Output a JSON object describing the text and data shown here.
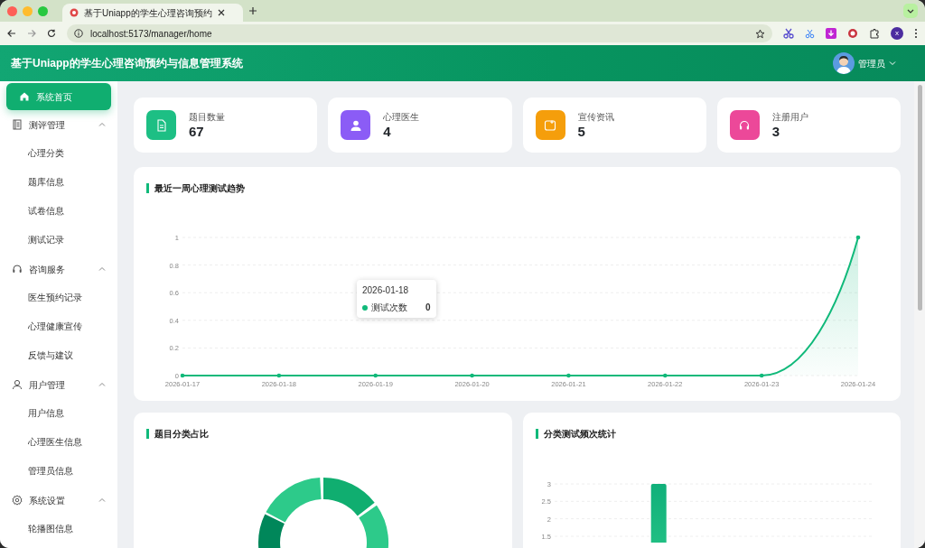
{
  "browser": {
    "tab": {
      "title": "基于Uniapp的学生心理咨询预约",
      "selected": true
    },
    "address": "localhost:5173/manager/home",
    "profile_initial": "x"
  },
  "header": {
    "title": "基于Uniapp的学生心理咨询预约与信息管理系统",
    "user": "管理员"
  },
  "sidebar": {
    "items": [
      {
        "label": "系统首页",
        "selected": true
      },
      {
        "label": "测评管理",
        "selected": false,
        "expanded": true,
        "children": [
          {
            "label": "心理分类",
            "selected": false
          },
          {
            "label": "题库信息",
            "selected": false
          },
          {
            "label": "试卷信息",
            "selected": false
          },
          {
            "label": "测试记录",
            "selected": false
          }
        ]
      },
      {
        "label": "咨询服务",
        "selected": false,
        "expanded": true,
        "children": [
          {
            "label": "医生预约记录",
            "selected": false
          },
          {
            "label": "心理健康宣传",
            "selected": false
          },
          {
            "label": "反馈与建议",
            "selected": false
          }
        ]
      },
      {
        "label": "用户管理",
        "selected": false,
        "expanded": true,
        "children": [
          {
            "label": "用户信息",
            "selected": false
          },
          {
            "label": "心理医生信息",
            "selected": false
          },
          {
            "label": "管理员信息",
            "selected": false
          }
        ]
      },
      {
        "label": "系统设置",
        "selected": false,
        "expanded": true,
        "children": [
          {
            "label": "轮播图信息",
            "selected": false
          }
        ]
      }
    ]
  },
  "stats": [
    {
      "label": "题目数量",
      "value": "67",
      "color": "#1dbf84"
    },
    {
      "label": "心理医生",
      "value": "4",
      "color": "#8b5cf6"
    },
    {
      "label": "宣传资讯",
      "value": "5",
      "color": "#f59e0b"
    },
    {
      "label": "注册用户",
      "value": "3",
      "color": "#ec4899"
    }
  ],
  "line_chart": {
    "title": "最近一周心理测试趋势",
    "tooltip": {
      "date": "2026-01-18",
      "value": "0"
    },
    "chart_data": {
      "type": "area",
      "categories": [
        "2026-01-17",
        "2026-01-18",
        "2026-01-19",
        "2026-01-20",
        "2026-01-21",
        "2026-01-22",
        "2026-01-23",
        "2026-01-24"
      ],
      "series": [
        {
          "name": "测试次数",
          "color": "#10b97a",
          "values": [
            0,
            0,
            0,
            0,
            0,
            0,
            0,
            1
          ]
        }
      ],
      "ylim": [
        0,
        1
      ],
      "yticks": [
        0,
        0.2,
        0.4,
        0.6,
        0.8,
        1
      ],
      "grid": true
    }
  },
  "donut_panel": {
    "title": "题目分类占比"
  },
  "bar_chart": {
    "title": "分类测试频次统计",
    "chart_data": {
      "type": "bar",
      "series": [
        {
          "color": "#10b07a",
          "values": [
            null,
            3,
            null,
            null,
            null
          ]
        }
      ],
      "ylim": [
        0,
        3
      ],
      "grid": true,
      "yticks": [
        {
          "value": 1.5,
          "label": "1.5"
        },
        {
          "value": 2,
          "label": "2"
        },
        {
          "value": 2.5,
          "label": "2.5"
        },
        {
          "value": 3,
          "label": "3"
        }
      ]
    }
  }
}
